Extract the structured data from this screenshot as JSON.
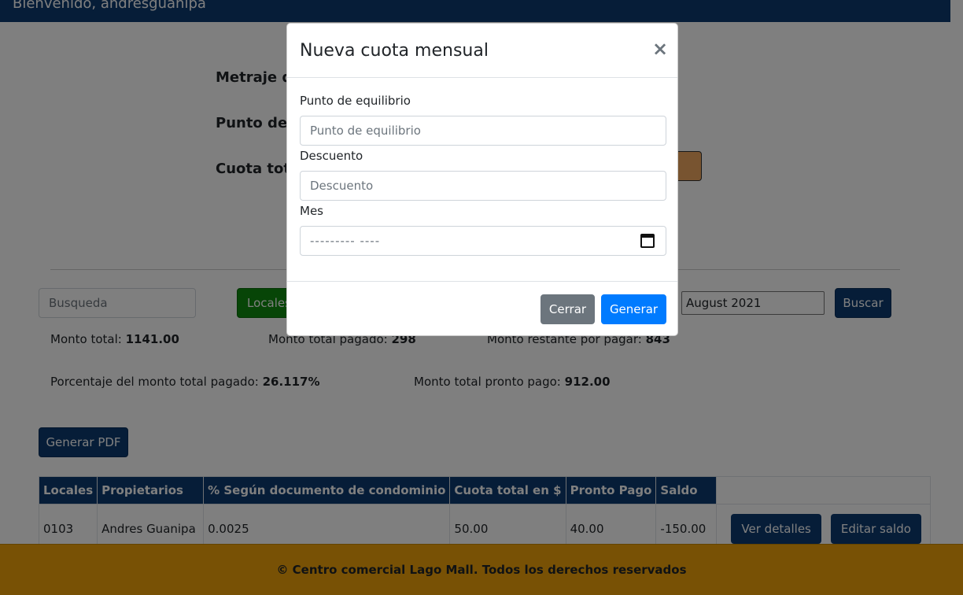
{
  "header": {
    "welcome": "Bienvenido, andresguanipa"
  },
  "summary_labels": {
    "metraje": "Metraje de",
    "punto": "Punto de",
    "cuota": "Cuota total"
  },
  "filters": {
    "search_placeholder": "Busqueda",
    "locales_button": "Locales",
    "month_value": "August 2021",
    "search_button": "Buscar"
  },
  "stats": {
    "monto_total_label": "Monto total:",
    "monto_total_value": "1141.00",
    "monto_pagado_label": "Monto total pagado:",
    "monto_pagado_value": "298",
    "monto_restante_label": "Monto restante por pagar:",
    "monto_restante_value": "843",
    "porcentaje_label": "Porcentaje del monto total pagado:",
    "porcentaje_value": "26.117%",
    "pronto_pago_label": "Monto total pronto pago:",
    "pronto_pago_value": "912.00"
  },
  "pdf_button": "Generar PDF",
  "table": {
    "headers": [
      "Locales",
      "Propietarios",
      "% Según documento de condominio",
      "Cuota total en $",
      "Pronto Pago",
      "Saldo"
    ],
    "rows": [
      {
        "cells": [
          "0103",
          "Andres Guanipa",
          "0.0025",
          "50.00",
          "40.00",
          "-150.00"
        ],
        "detail_button": "Ver detalles",
        "edit_button": "Editar saldo"
      }
    ]
  },
  "footer": {
    "text": "© Centro comercial Lago Mall. Todos los derechos reservados"
  },
  "modal": {
    "title": "Nueva cuota mensual",
    "close": "×",
    "fields": [
      {
        "label": "Punto de equilibrio",
        "placeholder": "Punto de equilibrio"
      },
      {
        "label": "Descuento",
        "placeholder": "Descuento"
      },
      {
        "label": "Mes",
        "placeholder": "--------- ----"
      }
    ],
    "cancel_button": "Cerrar",
    "submit_button": "Generar"
  },
  "colors": {
    "navy": "#0d3b70",
    "green": "#0f8a0f",
    "footer": "#f0a30a",
    "primary": "#007bff",
    "secondary": "#6c757d"
  }
}
